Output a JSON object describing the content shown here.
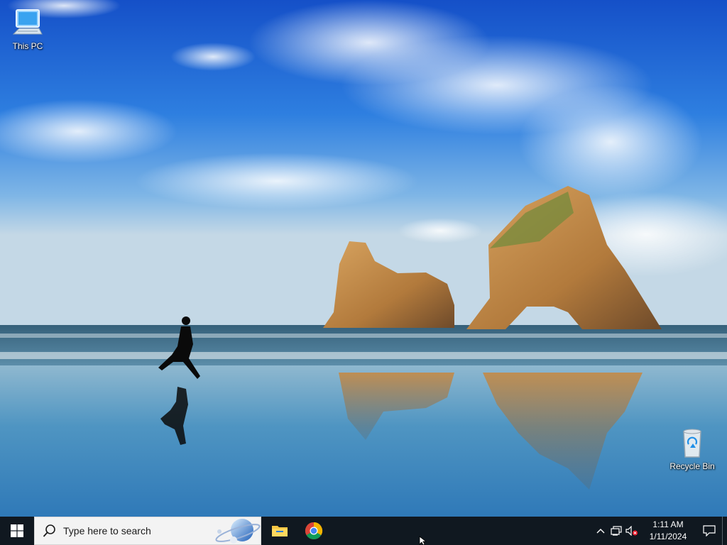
{
  "desktop": {
    "icons": [
      {
        "label": "This PC",
        "icon": "computer-icon"
      },
      {
        "label": "Recycle Bin",
        "icon": "recycle-bin-icon"
      }
    ],
    "wallpaper": "beach-rock-arches-runner"
  },
  "taskbar": {
    "start_icon": "windows-logo-icon",
    "search": {
      "placeholder": "Type here to search",
      "icon": "search-icon"
    },
    "pinned": [
      {
        "name": "File Explorer",
        "icon": "folder-icon"
      },
      {
        "name": "Google Chrome",
        "icon": "chrome-icon"
      }
    ],
    "tray": {
      "time": "1:11 AM",
      "date": "1/11/2024",
      "icons": [
        "chevron-up-icon",
        "network-icon",
        "volume-muted-icon"
      ]
    },
    "notification_icon": "action-center-icon"
  },
  "colors": {
    "taskbar_bg": "#101820",
    "search_bg": "#f3f3f3",
    "sky_top": "#1a5bd0",
    "sea": "#4a8fb5"
  }
}
